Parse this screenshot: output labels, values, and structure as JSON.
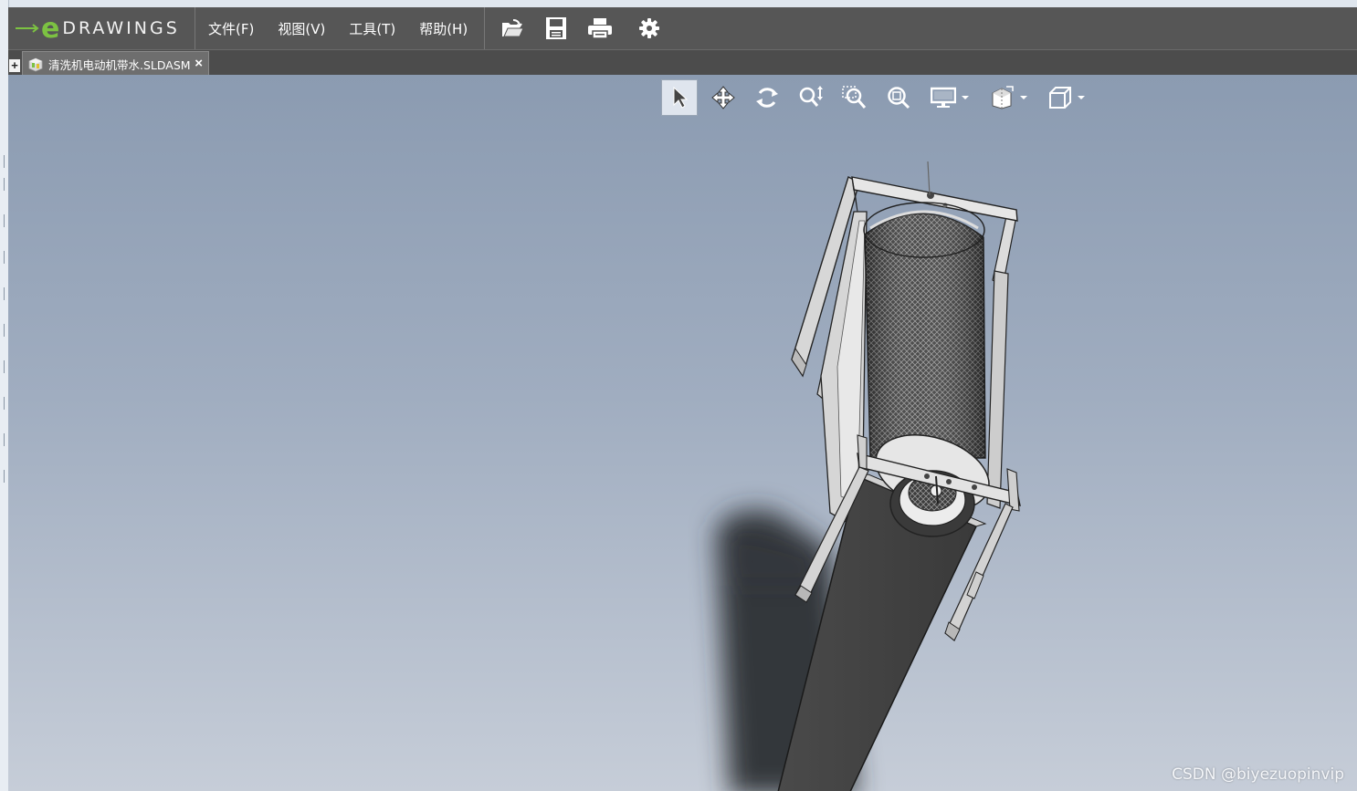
{
  "app": {
    "logo_text": "DRAWINGS"
  },
  "menu": {
    "items": [
      "文件(F)",
      "视图(V)",
      "工具(T)",
      "帮助(H)"
    ]
  },
  "toolbar": {
    "icons": [
      "open-icon",
      "save-icon",
      "print-icon",
      "gear-icon"
    ]
  },
  "tabs": {
    "new_tab_label": "+",
    "document": {
      "name": "清洗机电动机带水.SLDASM",
      "close_label": "×"
    }
  },
  "view_toolbar": {
    "icons": [
      "select-arrow-icon",
      "pan-icon",
      "rotate-icon",
      "zoom-icon",
      "zoom-to-area-icon",
      "zoom-to-fit-icon",
      "display-style-icon",
      "section-icon",
      "view-orientation-icon"
    ],
    "active": "select-arrow-icon"
  },
  "watermark": "CSDN @biyezuopinvip",
  "colors": {
    "menubar": "#565656",
    "tabbar": "#4c4c4c",
    "logo_accent": "#7cc242",
    "viewport_top": "#8b9bb1",
    "viewport_bottom": "#c6cdd8"
  }
}
